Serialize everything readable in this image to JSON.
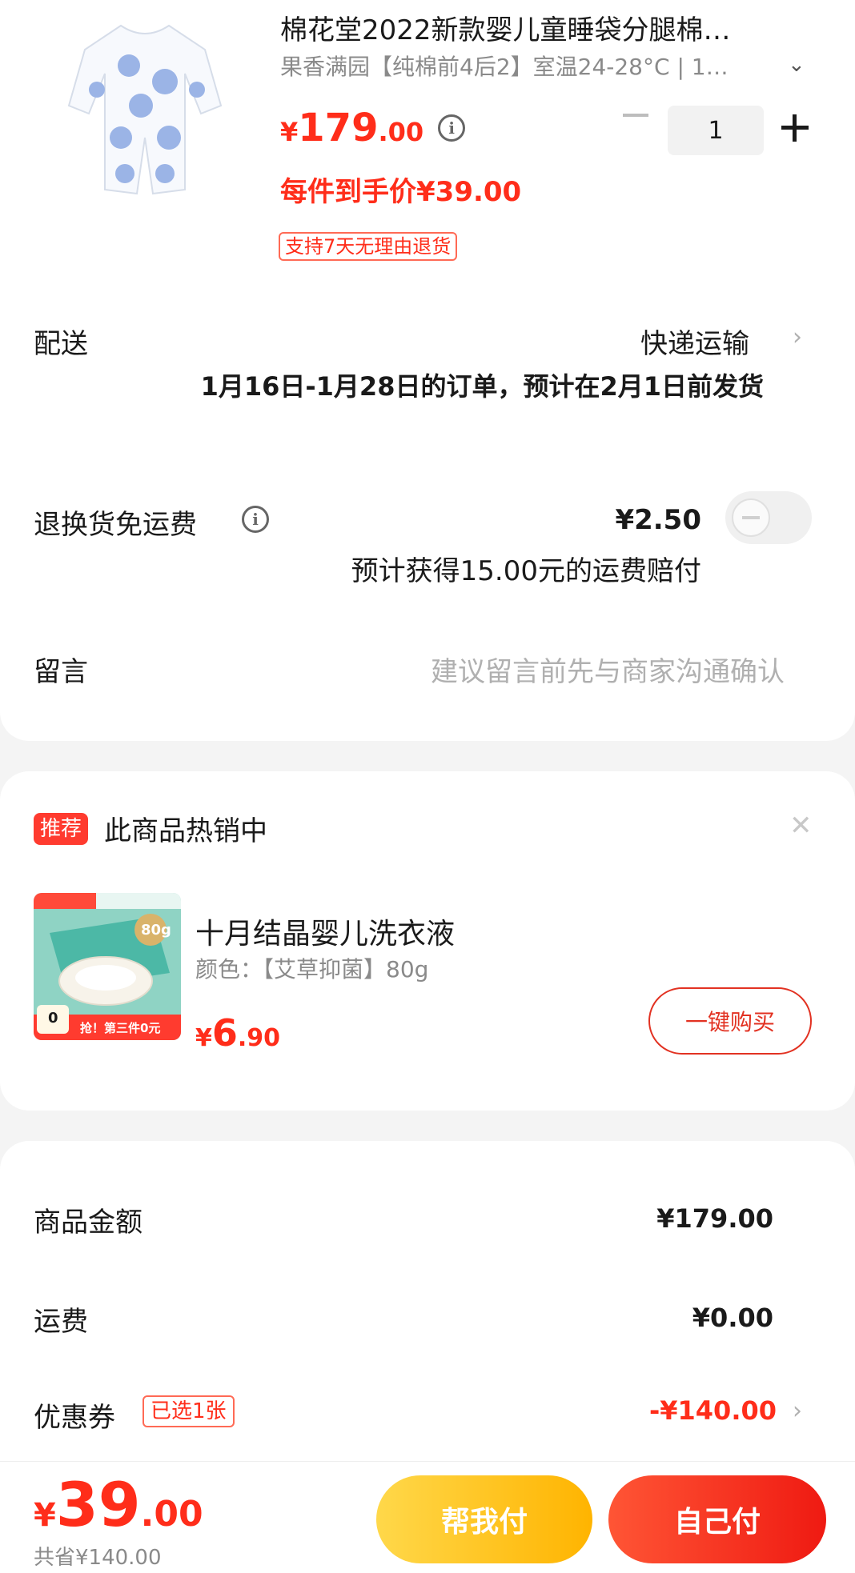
{
  "product": {
    "title": "棉花堂2022新款婴儿童睡袋分腿棉…",
    "sku": "果香满园【纯棉前4后2】室温24-28°C | 1…",
    "price_currency": "¥",
    "price_int": "179",
    "price_dec": ".00",
    "quantity": "1",
    "unit_price": "每件到手价¥39.00",
    "return_tag": "支持7天无理由退货"
  },
  "delivery": {
    "label": "配送",
    "method": "快递运输",
    "note": "1月16日-1月28日的订单，预计在2月1日前发货"
  },
  "return_shipping": {
    "label": "退换货免运费",
    "price": "¥2.50",
    "note": "预计获得15.00元的运费赔付"
  },
  "message": {
    "label": "留言",
    "placeholder": "建议留言前先与商家沟通确认"
  },
  "recommend": {
    "badge": "推荐",
    "title": "此商品热销中",
    "item_name": "十月结晶婴儿洗衣液",
    "item_sku": "颜色：【艾草抑菌】80g",
    "price_currency": "¥",
    "price_int": "6",
    "price_dec": ".90",
    "buy_label": "一键购买",
    "img_tag": "80g",
    "img_banner": "抢！第三件0元",
    "img_count": "0"
  },
  "summary": {
    "goods_label": "商品金额",
    "goods_value": "¥179.00",
    "shipping_label": "运费",
    "shipping_value": "¥0.00",
    "coupon_label": "优惠券",
    "coupon_tag": "已选1张",
    "coupon_value": "-¥140.00"
  },
  "footer": {
    "total_currency": "¥",
    "total_int": "39",
    "total_dec": ".00",
    "saved": "共省¥140.00",
    "help_pay": "帮我付",
    "self_pay": "自己付"
  },
  "colors": {
    "accent_red": "#ff2d1a",
    "help_yellow": "#ffc21a",
    "pay_red": "#ef1a12"
  }
}
